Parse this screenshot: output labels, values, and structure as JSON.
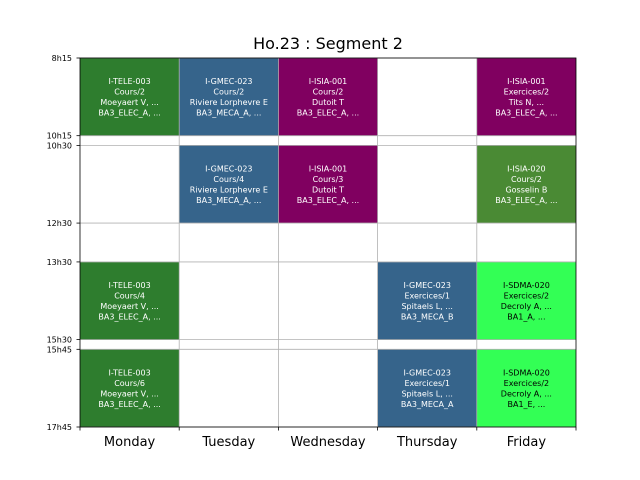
{
  "chart_data": {
    "type": "table",
    "title": "Ho.23 : Segment 2",
    "days": [
      "Monday",
      "Tuesday",
      "Wednesday",
      "Thursday",
      "Friday"
    ],
    "y_ticks": [
      "8h15",
      "10h15",
      "10h30",
      "12h30",
      "13h30",
      "15h30",
      "15h45",
      "17h45"
    ],
    "y_tick_minutes": [
      495,
      615,
      630,
      750,
      810,
      930,
      945,
      1065
    ],
    "y_range_minutes": [
      495,
      1065
    ],
    "grid": true,
    "colors": {
      "tele": "#2e7d2e",
      "gmec": "#36648b",
      "isia": "#800060",
      "isia_green": "#4a8a34",
      "sdma": "#33ff55"
    },
    "events": [
      {
        "day": 0,
        "start": 495,
        "end": 615,
        "color": "tele",
        "dark_text": false,
        "lines": [
          "I-TELE-003",
          "Cours/2",
          "Moeyaert V, ...",
          "BA3_ELEC_A, ..."
        ]
      },
      {
        "day": 1,
        "start": 495,
        "end": 615,
        "color": "gmec",
        "dark_text": false,
        "lines": [
          "I-GMEC-023",
          "Cours/2",
          "Riviere Lorphevre E",
          "BA3_MECA_A, ..."
        ]
      },
      {
        "day": 2,
        "start": 495,
        "end": 615,
        "color": "isia",
        "dark_text": false,
        "lines": [
          "I-ISIA-001",
          "Cours/2",
          "Dutoit T",
          "BA3_ELEC_A, ..."
        ]
      },
      {
        "day": 4,
        "start": 495,
        "end": 615,
        "color": "isia",
        "dark_text": false,
        "lines": [
          "I-ISIA-001",
          "Exercices/2",
          "Tits N, ...",
          "BA3_ELEC_A, ..."
        ]
      },
      {
        "day": 1,
        "start": 630,
        "end": 750,
        "color": "gmec",
        "dark_text": false,
        "lines": [
          "I-GMEC-023",
          "Cours/4",
          "Riviere Lorphevre E",
          "BA3_MECA_A, ..."
        ]
      },
      {
        "day": 2,
        "start": 630,
        "end": 750,
        "color": "isia",
        "dark_text": false,
        "lines": [
          "I-ISIA-001",
          "Cours/3",
          "Dutoit T",
          "BA3_ELEC_A, ..."
        ]
      },
      {
        "day": 4,
        "start": 630,
        "end": 750,
        "color": "isia_green",
        "dark_text": false,
        "lines": [
          "I-ISIA-020",
          "Cours/2",
          "Gosselin B",
          "BA3_ELEC_A, ..."
        ]
      },
      {
        "day": 0,
        "start": 810,
        "end": 930,
        "color": "tele",
        "dark_text": false,
        "lines": [
          "I-TELE-003",
          "Cours/4",
          "Moeyaert V, ...",
          "BA3_ELEC_A, ..."
        ]
      },
      {
        "day": 3,
        "start": 810,
        "end": 930,
        "color": "gmec",
        "dark_text": false,
        "lines": [
          "I-GMEC-023",
          "Exercices/1",
          "Spitaels L, ...",
          "BA3_MECA_B"
        ]
      },
      {
        "day": 4,
        "start": 810,
        "end": 930,
        "color": "sdma",
        "dark_text": true,
        "lines": [
          "I-SDMA-020",
          "Exercices/2",
          "Decroly A, ...",
          "BA1_A, ..."
        ]
      },
      {
        "day": 0,
        "start": 945,
        "end": 1065,
        "color": "tele",
        "dark_text": false,
        "lines": [
          "I-TELE-003",
          "Cours/6",
          "Moeyaert V, ...",
          "BA3_ELEC_A, ..."
        ]
      },
      {
        "day": 3,
        "start": 945,
        "end": 1065,
        "color": "gmec",
        "dark_text": false,
        "lines": [
          "I-GMEC-023",
          "Exercices/1",
          "Spitaels L, ...",
          "BA3_MECA_A"
        ]
      },
      {
        "day": 4,
        "start": 945,
        "end": 1065,
        "color": "sdma",
        "dark_text": true,
        "lines": [
          "I-SDMA-020",
          "Exercices/2",
          "Decroly A, ...",
          "BA1_E, ..."
        ]
      }
    ]
  }
}
